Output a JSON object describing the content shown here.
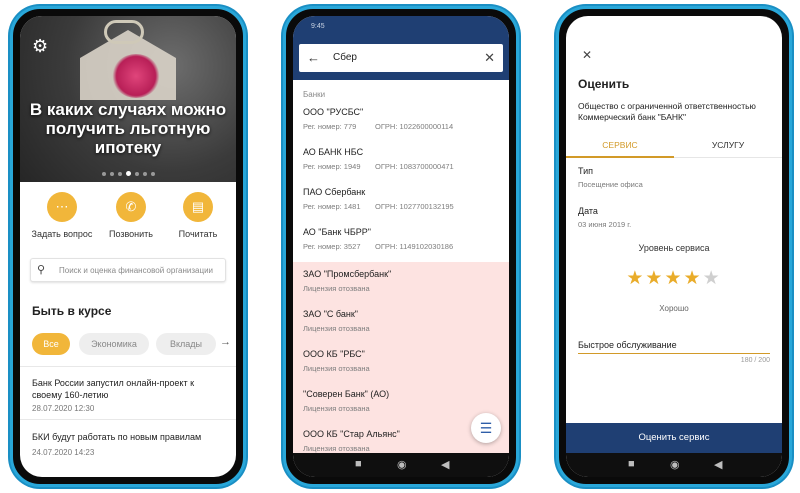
{
  "screen1": {
    "hero_title": "В каких случаях можно получить льготную ипотеку",
    "icons": {
      "settings": "gear-icon"
    },
    "actions": [
      {
        "label": "Задать вопрос",
        "icon": "chat-icon"
      },
      {
        "label": "Позвонить",
        "icon": "phone-icon"
      },
      {
        "label": "Почитать",
        "icon": "book-icon"
      }
    ],
    "search_placeholder": "Поиск и оценка финансовой организации",
    "section_title": "Быть в курсе",
    "chips": [
      "Все",
      "Экономика",
      "Вклады"
    ],
    "news": [
      {
        "title": "Банк России запустил онлайн-проект к своему 160-летию",
        "date": "28.07.2020 12:30"
      },
      {
        "title": "БКИ будут работать по новым правилам",
        "date": "24.07.2020 14:23"
      }
    ],
    "accent": "#f1b63a"
  },
  "screen2": {
    "status_time": "9:45",
    "search_value": "Сбер",
    "category": "Банки",
    "banks": [
      {
        "name": "ООО \"РУСБС\"",
        "reg": "Рег. номер: 779",
        "ogrn": "ОГРН: 1022600000114"
      },
      {
        "name": "АО БАНК НБС",
        "reg": "Рег. номер: 1949",
        "ogrn": "ОГРН: 1083700000471"
      },
      {
        "name": "ПАО Сбербанк",
        "reg": "Рег. номер: 1481",
        "ogrn": "ОГРН: 1027700132195"
      },
      {
        "name": "АО \"Банк ЧБРР\"",
        "reg": "Рег. номер: 3527",
        "ogrn": "ОГРН: 1149102030186"
      }
    ],
    "revoked": [
      {
        "name": "ЗАО \"Промсбербанк\"",
        "status": "Лицензия отозвана"
      },
      {
        "name": "ЗАО \"С банк\"",
        "status": "Лицензия отозвана"
      },
      {
        "name": "ООО КБ \"РБС\"",
        "status": "Лицензия отозвана"
      },
      {
        "name": "\"Соверен Банк\" (АО)",
        "status": "Лицензия отозвана"
      },
      {
        "name": "ООО КБ \"Стар Альянс\"",
        "status": "Лицензия отозвана"
      }
    ],
    "header_color": "#1f3f73",
    "revoked_color": "#fde3e1"
  },
  "screen3": {
    "title": "Оценить",
    "org_name": "Общество с ограниченной ответственностью Коммерческий банк \"БАНК\"",
    "tabs": [
      "СЕРВИС",
      "УСЛУГУ"
    ],
    "fields": [
      {
        "label": "Тип",
        "value": "Посещение офиса"
      },
      {
        "label": "Дата",
        "value": "03 июня 2019 г."
      }
    ],
    "service_level_label": "Уровень сервиса",
    "rating": 4,
    "rating_max": 5,
    "rating_text": "Хорошо",
    "comment": "Быстрое обслуживание",
    "char_count": "180 / 200",
    "submit_label": "Оценить сервис"
  }
}
